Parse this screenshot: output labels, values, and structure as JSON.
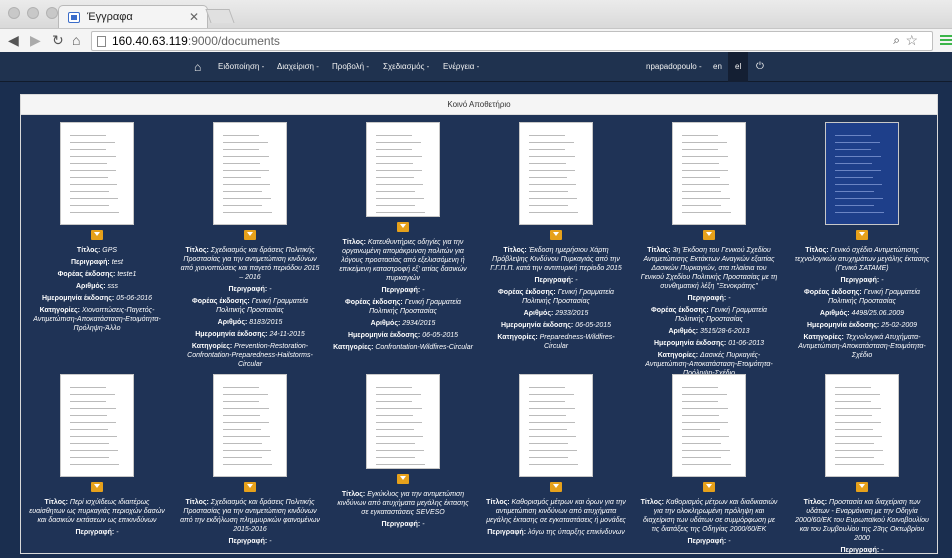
{
  "browser": {
    "tab_title": "Έγγραφα",
    "url_host": "160.40.63.119",
    "url_path": ":9000/documents"
  },
  "nav": {
    "items": [
      "Ειδοποίηση -",
      "Διαχείριση -",
      "Προβολή -",
      "Σχεδιασμός -",
      "Ενέργεια -"
    ],
    "user": "npapadopoulo -",
    "lang_en": "en",
    "lang_el": "el"
  },
  "panel": {
    "title": "Κοινό Αποθετήριο"
  },
  "labels": {
    "title": "Τίτλος:",
    "desc": "Περιγραφή:",
    "issuer": "Φορέας έκδοσης:",
    "number": "Αριθμός:",
    "date": "Ημερομηνία έκδοσης:",
    "categories": "Κατηγορίες:"
  },
  "documents": [
    {
      "title": "GPS",
      "desc": "test",
      "issuer": "teste1",
      "number": "sss",
      "date": "05-06-2016",
      "categories": "Χιονοπτώσεις-Παγετός-Αντιμετώπιση-Αποκατάσταση-Ετοιμότητα-Πρόληψη-Άλλο"
    },
    {
      "title": "Σχεδιασμός και δράσεις Πολιτικής Προστασίας για την αντιμετώπιση κινδύνων από χιονοπτώσεις και παγετό περιόδου 2015 – 2016",
      "desc": "-",
      "issuer": "Γενική Γραμματεία Πολιτικής Προστασίας",
      "number": "8183/2015",
      "date": "24-11-2015",
      "categories": "Prevention-Restoration-Confrontation-Preparedness-Hailstorms-Circular"
    },
    {
      "title": "Κατευθυντήριες οδηγίες για την οργανωμένη απομάκρυνση πολιτών για λόγους προστασίας από εξελισσόμενη ή επικείμενη καταστροφή εξ' αιτίας δασικών πυρκαγιών",
      "desc": "-",
      "issuer": "Γενική Γραμματεία Πολιτικής Προστασίας",
      "number": "2934/2015",
      "date": "06-05-2015",
      "categories": "Confrontation-Wildfires-Circular"
    },
    {
      "title": "Έκδοση ημερήσιου Χάρτη Πρόβλεψης Κινδύνου Πυρκαγιάς από την Γ.Γ.Π.Π. κατά την αντιπυρική περίοδο 2015",
      "desc": "-",
      "issuer": "Γενική Γραμματεία Πολιτικής Προστασίας",
      "number": "2933/2015",
      "date": "06-05-2015",
      "categories": "Preparedness-Wildfires-Circular"
    },
    {
      "title": "3η Έκδοση του Γενικού Σχεδίου Αντιμετώπισης Εκτάκτων Αναγκών εξαιτίας Δασικών Πυρκαγιών, στα πλαίσια του Γενικού Σχεδίου Πολιτικής Προστασίας με τη συνθηματική λέξη \"Ξενοκράτης\"",
      "desc": "-",
      "issuer": "Γενική Γραμματεία Πολιτικής Προστασίας",
      "number": "3515/28-6-2013",
      "date": "01-06-2013",
      "categories": "Δασικές Πυρκαγιές-Αντιμετώπιση-Αποκατάσταση-Ετοιμότητα-Πρόληψη-Σχέδιο"
    },
    {
      "title": "Γενικό σχέδιο Αντιμετώπισης τεχνολογικών ατυχημάτων μεγάλης έκτασης (Γενικό ΣΑΤΑΜΕ)",
      "desc": "-",
      "issuer": "Γενική Γραμματεία Πολιτικής Προστασίας",
      "number": "4498/25.06.2009",
      "date": "25-02-2009",
      "categories": "Τεχνολογικά Ατυχήματα-Αντιμετώπιση-Αποκατάσταση-Ετοιμότητα-Σχέδιο"
    },
    {
      "title": "Περί ισχύϊδεως ιδιαιτέρως ευαίσθητων ως πυρκαγιάς περιοχών δασών και δασικών εκτάσεων ως επικινδύνων",
      "desc": "-"
    },
    {
      "title": "Σχεδιασμός και δράσεις Πολιτικής Προστασίας για την αντιμετώπιση κινδύνων από την εκδήλωση πλημμυρικών φαινομένων 2015-2016",
      "desc": "-"
    },
    {
      "title": "Εγκύκλιος για την αντιμετώπιση κινδύνων από ατυχήματα μεγάλης έκτασης σε εγκαταστάσεις SEVESO",
      "desc": "-"
    },
    {
      "title": "Καθορισμός μέτρων και όρων για την αντιμετώπιση κινδύνων από ατυχήματα μεγάλης έκτασης σε εγκαταστάσεις ή μονάδες",
      "desc": "λόγω της ύπαρξης επικίνδυνων"
    },
    {
      "title": "Καθορισμός μέτρων και διαδικασιών για την ολοκληρωμένη πρόληψη και διαχείριση των υδάτων σε συμμόρφωση με τις διατάξεις της Οδηγίας 2000/60/ΕΚ",
      "desc": "-"
    },
    {
      "title": "Προστασία και διαχείριση των υδάτων - Εναρμόνιση με την Οδηγία 2000/60/ΕΚ του Ευρωπαϊκού Κοινοβουλίου και του Συμβουλίου της 23ης Οκτωβρίου 2000",
      "desc": "-"
    }
  ]
}
